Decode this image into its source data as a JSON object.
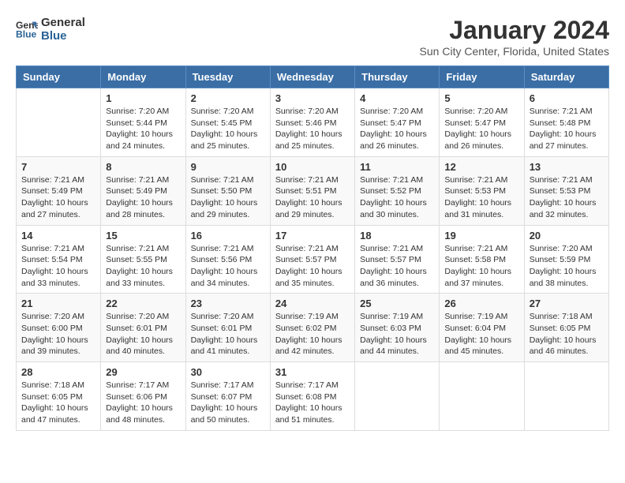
{
  "header": {
    "logo_line1": "General",
    "logo_line2": "Blue",
    "month": "January 2024",
    "location": "Sun City Center, Florida, United States"
  },
  "weekdays": [
    "Sunday",
    "Monday",
    "Tuesday",
    "Wednesday",
    "Thursday",
    "Friday",
    "Saturday"
  ],
  "weeks": [
    [
      {
        "day": "",
        "info": ""
      },
      {
        "day": "1",
        "info": "Sunrise: 7:20 AM\nSunset: 5:44 PM\nDaylight: 10 hours\nand 24 minutes."
      },
      {
        "day": "2",
        "info": "Sunrise: 7:20 AM\nSunset: 5:45 PM\nDaylight: 10 hours\nand 25 minutes."
      },
      {
        "day": "3",
        "info": "Sunrise: 7:20 AM\nSunset: 5:46 PM\nDaylight: 10 hours\nand 25 minutes."
      },
      {
        "day": "4",
        "info": "Sunrise: 7:20 AM\nSunset: 5:47 PM\nDaylight: 10 hours\nand 26 minutes."
      },
      {
        "day": "5",
        "info": "Sunrise: 7:20 AM\nSunset: 5:47 PM\nDaylight: 10 hours\nand 26 minutes."
      },
      {
        "day": "6",
        "info": "Sunrise: 7:21 AM\nSunset: 5:48 PM\nDaylight: 10 hours\nand 27 minutes."
      }
    ],
    [
      {
        "day": "7",
        "info": "Sunrise: 7:21 AM\nSunset: 5:49 PM\nDaylight: 10 hours\nand 27 minutes."
      },
      {
        "day": "8",
        "info": "Sunrise: 7:21 AM\nSunset: 5:49 PM\nDaylight: 10 hours\nand 28 minutes."
      },
      {
        "day": "9",
        "info": "Sunrise: 7:21 AM\nSunset: 5:50 PM\nDaylight: 10 hours\nand 29 minutes."
      },
      {
        "day": "10",
        "info": "Sunrise: 7:21 AM\nSunset: 5:51 PM\nDaylight: 10 hours\nand 29 minutes."
      },
      {
        "day": "11",
        "info": "Sunrise: 7:21 AM\nSunset: 5:52 PM\nDaylight: 10 hours\nand 30 minutes."
      },
      {
        "day": "12",
        "info": "Sunrise: 7:21 AM\nSunset: 5:53 PM\nDaylight: 10 hours\nand 31 minutes."
      },
      {
        "day": "13",
        "info": "Sunrise: 7:21 AM\nSunset: 5:53 PM\nDaylight: 10 hours\nand 32 minutes."
      }
    ],
    [
      {
        "day": "14",
        "info": "Sunrise: 7:21 AM\nSunset: 5:54 PM\nDaylight: 10 hours\nand 33 minutes."
      },
      {
        "day": "15",
        "info": "Sunrise: 7:21 AM\nSunset: 5:55 PM\nDaylight: 10 hours\nand 33 minutes."
      },
      {
        "day": "16",
        "info": "Sunrise: 7:21 AM\nSunset: 5:56 PM\nDaylight: 10 hours\nand 34 minutes."
      },
      {
        "day": "17",
        "info": "Sunrise: 7:21 AM\nSunset: 5:57 PM\nDaylight: 10 hours\nand 35 minutes."
      },
      {
        "day": "18",
        "info": "Sunrise: 7:21 AM\nSunset: 5:57 PM\nDaylight: 10 hours\nand 36 minutes."
      },
      {
        "day": "19",
        "info": "Sunrise: 7:21 AM\nSunset: 5:58 PM\nDaylight: 10 hours\nand 37 minutes."
      },
      {
        "day": "20",
        "info": "Sunrise: 7:20 AM\nSunset: 5:59 PM\nDaylight: 10 hours\nand 38 minutes."
      }
    ],
    [
      {
        "day": "21",
        "info": "Sunrise: 7:20 AM\nSunset: 6:00 PM\nDaylight: 10 hours\nand 39 minutes."
      },
      {
        "day": "22",
        "info": "Sunrise: 7:20 AM\nSunset: 6:01 PM\nDaylight: 10 hours\nand 40 minutes."
      },
      {
        "day": "23",
        "info": "Sunrise: 7:20 AM\nSunset: 6:01 PM\nDaylight: 10 hours\nand 41 minutes."
      },
      {
        "day": "24",
        "info": "Sunrise: 7:19 AM\nSunset: 6:02 PM\nDaylight: 10 hours\nand 42 minutes."
      },
      {
        "day": "25",
        "info": "Sunrise: 7:19 AM\nSunset: 6:03 PM\nDaylight: 10 hours\nand 44 minutes."
      },
      {
        "day": "26",
        "info": "Sunrise: 7:19 AM\nSunset: 6:04 PM\nDaylight: 10 hours\nand 45 minutes."
      },
      {
        "day": "27",
        "info": "Sunrise: 7:18 AM\nSunset: 6:05 PM\nDaylight: 10 hours\nand 46 minutes."
      }
    ],
    [
      {
        "day": "28",
        "info": "Sunrise: 7:18 AM\nSunset: 6:05 PM\nDaylight: 10 hours\nand 47 minutes."
      },
      {
        "day": "29",
        "info": "Sunrise: 7:17 AM\nSunset: 6:06 PM\nDaylight: 10 hours\nand 48 minutes."
      },
      {
        "day": "30",
        "info": "Sunrise: 7:17 AM\nSunset: 6:07 PM\nDaylight: 10 hours\nand 50 minutes."
      },
      {
        "day": "31",
        "info": "Sunrise: 7:17 AM\nSunset: 6:08 PM\nDaylight: 10 hours\nand 51 minutes."
      },
      {
        "day": "",
        "info": ""
      },
      {
        "day": "",
        "info": ""
      },
      {
        "day": "",
        "info": ""
      }
    ]
  ]
}
